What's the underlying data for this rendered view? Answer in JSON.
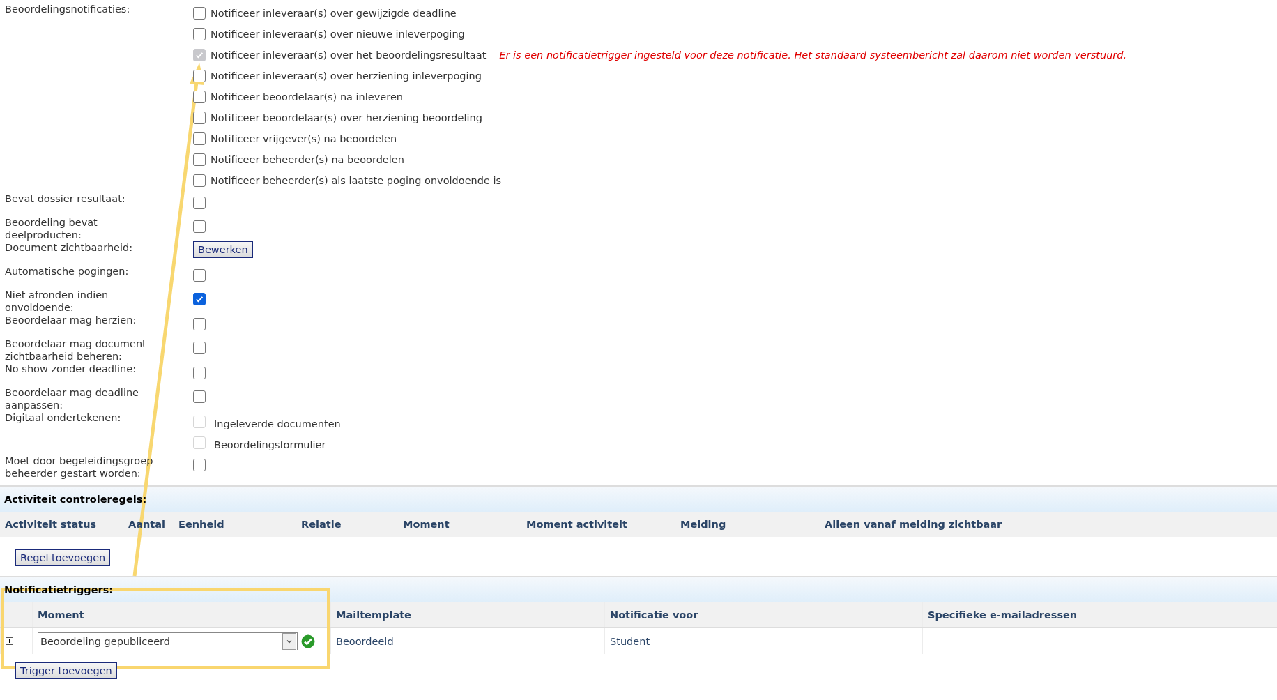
{
  "form": {
    "rows": [
      {
        "kind": "checklist",
        "label": "Beoordelingsnotificaties:",
        "options": [
          {
            "text": "Notificeer inleveraar(s) over gewijzigde deadline",
            "checked": false,
            "disabled": false
          },
          {
            "text": "Notificeer inleveraar(s) over nieuwe inleverpoging",
            "checked": false,
            "disabled": false
          },
          {
            "text": "Notificeer inleveraar(s) over het beoordelingsresultaat",
            "checked": true,
            "disabled": true,
            "note": "Er is een notificatietrigger ingesteld voor deze notificatie. Het standaard systeembericht zal daarom niet worden verstuurd."
          },
          {
            "text": "Notificeer inleveraar(s) over herziening inleverpoging",
            "checked": false,
            "disabled": false
          },
          {
            "text": "Notificeer beoordelaar(s) na inleveren",
            "checked": false,
            "disabled": false
          },
          {
            "text": "Notificeer beoordelaar(s) over herziening beoordeling",
            "checked": false,
            "disabled": false
          },
          {
            "text": "Notificeer vrijgever(s) na beoordelen",
            "checked": false,
            "disabled": false
          },
          {
            "text": "Notificeer beheerder(s) na beoordelen",
            "checked": false,
            "disabled": false
          },
          {
            "text": "Notificeer beheerder(s) als laatste poging onvoldoende is",
            "checked": false,
            "disabled": false
          }
        ]
      },
      {
        "kind": "checkbox",
        "label": "Bevat dossier resultaat:",
        "checked": false,
        "disabled": false
      },
      {
        "kind": "checkbox",
        "label": "Beoordeling bevat\ndeelproducten:",
        "checked": false,
        "disabled": false
      },
      {
        "kind": "button",
        "label": "Document zichtbaarheid:",
        "button": "Bewerken"
      },
      {
        "kind": "checkbox",
        "label": "Automatische pogingen:",
        "checked": false,
        "disabled": false
      },
      {
        "kind": "checkbox",
        "label": "Niet afronden indien\nonvoldoende:",
        "checked": true,
        "disabled": false
      },
      {
        "kind": "checkbox",
        "label": "Beoordelaar mag herzien:",
        "checked": false,
        "disabled": false
      },
      {
        "kind": "checkbox",
        "label": "Beoordelaar mag document\nzichtbaarheid beheren:",
        "checked": false,
        "disabled": false
      },
      {
        "kind": "checkbox",
        "label": "No show zonder deadline:",
        "checked": false,
        "disabled": false
      },
      {
        "kind": "checkbox",
        "label": "Beoordelaar mag deadline\naanpassen:",
        "checked": false,
        "disabled": false
      },
      {
        "kind": "checklist",
        "label": "Digitaal ondertekenen:",
        "options": [
          {
            "text": "Ingeleverde documenten",
            "checked": false,
            "disabled": true
          },
          {
            "text": "Beoordelingsformulier",
            "checked": false,
            "disabled": true
          }
        ]
      },
      {
        "kind": "checkbox",
        "label": "Moet door begeleidingsgroep\nbeheerder gestart worden:",
        "checked": false,
        "disabled": false
      }
    ]
  },
  "rules": {
    "title": "Activiteit controleregels:",
    "columns": [
      "Activiteit status",
      "Aantal",
      "Eenheid",
      "Relatie",
      "Moment",
      "Moment activiteit",
      "Melding",
      "Alleen vanaf melding zichtbaar"
    ],
    "button": "Regel toevoegen"
  },
  "triggers": {
    "title": "Notificatietriggers:",
    "columns": [
      "Moment",
      "Mailtemplate",
      "Notificatie voor",
      "Specifieke e-mailadressen"
    ],
    "rows": [
      {
        "moment": "Beoordeling gepubliceerd",
        "mailtemplate": "Beoordeeld",
        "recipient": "Student",
        "valid": true
      }
    ],
    "button": "Trigger toevoegen"
  }
}
